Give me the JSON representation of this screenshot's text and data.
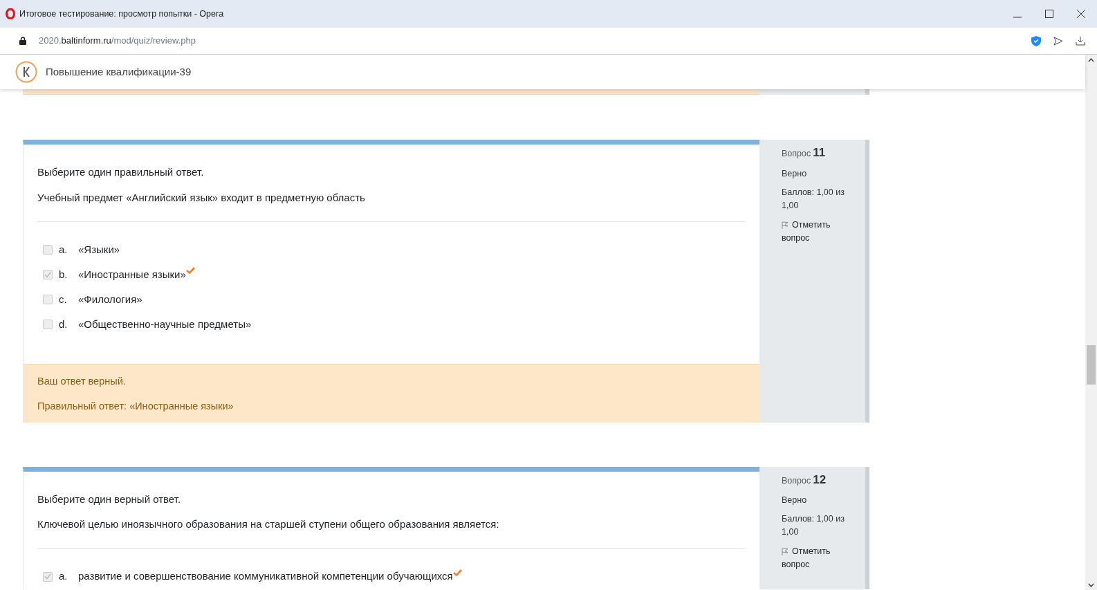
{
  "window": {
    "title": "Итоговое тестирование: просмотр попытки - Opera"
  },
  "address_bar": {
    "url": {
      "prefix": "2020.",
      "host": "baltinform.ru",
      "path": "/mod/quiz/review.php"
    }
  },
  "site_header": {
    "title": "Повышение квалификации-39"
  },
  "questions": [
    {
      "number_label": "Вопрос",
      "number": "11",
      "state": "Верно",
      "grade": "Баллов: 1,00 из 1,00",
      "flag_label": "Отметить вопрос",
      "prompt": "Выберите один правильный ответ.",
      "text": "Учебный предмет «Английский язык» входит в предметную область",
      "answers": [
        {
          "letter": "a.",
          "text": "«Языки»",
          "checked": false,
          "correct": false
        },
        {
          "letter": "b.",
          "text": "«Иностранные языки»",
          "checked": true,
          "correct": true
        },
        {
          "letter": "c.",
          "text": "«Филология»",
          "checked": false,
          "correct": false
        },
        {
          "letter": "d.",
          "text": "«Общественно-научные предметы»",
          "checked": false,
          "correct": false
        }
      ],
      "feedback": {
        "general": "Ваш ответ верный.",
        "right_answer": "Правильный ответ: «Иностранные языки»"
      }
    },
    {
      "number_label": "Вопрос",
      "number": "12",
      "state": "Верно",
      "grade": "Баллов: 1,00 из 1,00",
      "flag_label": "Отметить вопрос",
      "prompt": "Выберите один верный ответ.",
      "text": "Ключевой целью иноязычного образования на старшей ступени общего образования является:",
      "answers": [
        {
          "letter": "a.",
          "text": "развитие и совершенствование коммуникативной компетенции обучающихся",
          "checked": true,
          "correct": true
        }
      ]
    }
  ]
}
